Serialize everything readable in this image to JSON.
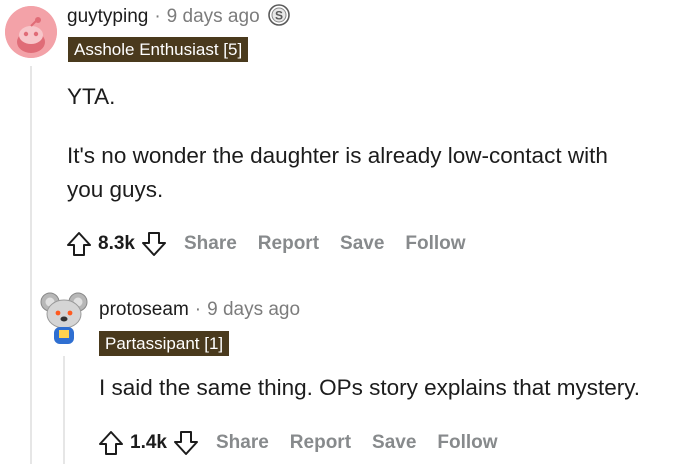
{
  "comment1": {
    "username": "guytyping",
    "separator": "·",
    "time": "9 days ago",
    "award_icon": "silver-coin-award-icon",
    "flair": "Asshole Enthusiast [5]",
    "body": [
      "YTA.",
      "It's no wonder the daughter is already low-contact with",
      "you guys."
    ],
    "score": "8.3k",
    "actions": {
      "share": "Share",
      "report": "Report",
      "save": "Save",
      "follow": "Follow"
    }
  },
  "comment2": {
    "username": "protoseam",
    "separator": "·",
    "time": "9 days ago",
    "flair": "Partassipant [1]",
    "body": [
      "I said the same thing. OPs story explains that mystery."
    ],
    "score": "1.4k",
    "actions": {
      "share": "Share",
      "report": "Report",
      "save": "Save",
      "follow": "Follow"
    }
  },
  "colors": {
    "flair_bg": "#4a3a1d",
    "avatar1_bg": "#f3a2a8",
    "muted_text": "#7c7c7c",
    "action_text": "#878a8c",
    "thread_line": "#e6e6e6"
  }
}
